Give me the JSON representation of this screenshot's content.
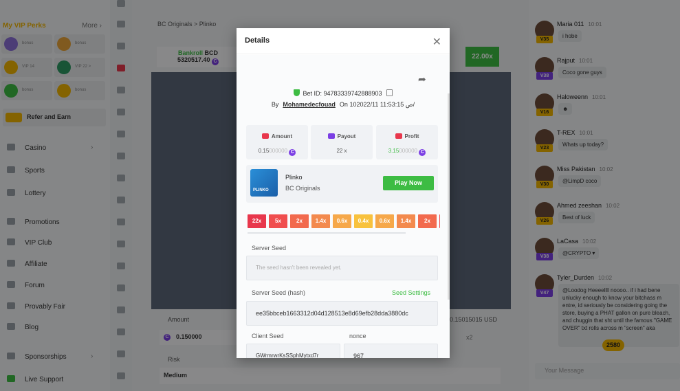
{
  "sidebar": {
    "vip_perks_title": "My VIP Perks",
    "vip_more": "More",
    "vip_cells": [
      {
        "label": "bonus"
      },
      {
        "label": "bonus"
      },
      {
        "label": "VIP 14"
      },
      {
        "label": "VIP 22 >"
      },
      {
        "label": "bonus"
      },
      {
        "label": "bonus"
      }
    ],
    "refer": "Refer and Earn",
    "nav": [
      {
        "label": "Casino",
        "chevron": true
      },
      {
        "label": "Sports",
        "chevron": false
      },
      {
        "label": "Lottery",
        "chevron": false
      },
      {
        "label": "Promotions",
        "chevron": false
      },
      {
        "label": "VIP Club",
        "chevron": false
      },
      {
        "label": "Affiliate",
        "chevron": false
      },
      {
        "label": "Forum",
        "chevron": false
      },
      {
        "label": "Provably Fair",
        "chevron": false
      },
      {
        "label": "Blog",
        "chevron": false
      },
      {
        "label": "Sponsorships",
        "chevron": true
      },
      {
        "label": "Live Support",
        "chevron": false
      }
    ]
  },
  "main": {
    "breadcrumb": "BC Originals  >  Plinko",
    "bankroll_label": "Bankroll",
    "bankroll_currency": "BCD",
    "bankroll_value": "5320517.40",
    "history_value": "22.00x",
    "amount_label": "Amount",
    "amount_value": "0.150000",
    "amount_usd": "0.15015015 USD",
    "amount_x2": "x2",
    "risk_label": "Risk",
    "risk_value": "Medium"
  },
  "chat": {
    "messages": [
      {
        "user": "Maria 011",
        "time": "10:01",
        "level": "V35",
        "text": "i hobe"
      },
      {
        "user": "Rajput",
        "time": "10:01",
        "level": "V38",
        "text": "Coco gone guys"
      },
      {
        "user": "Haloweenn",
        "time": "10:01",
        "level": "V16",
        "text": "☻"
      },
      {
        "user": "T-REX",
        "time": "10:01",
        "level": "V23",
        "text": "Whats up today?"
      },
      {
        "user": "Miss Pakistan",
        "time": "10:02",
        "level": "V30",
        "text": "@LimpD coco"
      },
      {
        "user": "Ahmed zeeshan",
        "time": "10:02",
        "level": "V26",
        "text": "Best of luck"
      },
      {
        "user": "LaCasa",
        "time": "10:02",
        "level": "V38",
        "text": "@CRYPTO ▾"
      },
      {
        "user": "Tyler_Durden",
        "time": "10:02",
        "level": "V47",
        "text": "@Loodog Heeeellll noooo.. if i had bene unlucky enough to know your bitchass m entre, id seriously be considering going the store, buying a PHAT gallon on pure bleach, and chuggin that sht until the famous \"GAME OVER\" txt rolls across m \"screen\" aka"
      }
    ],
    "unread_count": "2580",
    "input_placeholder": "Your Message"
  },
  "modal": {
    "title": "Details",
    "bet_id_label": "Bet ID:",
    "bet_id": "94783339742888903",
    "by_label": "By",
    "username": "Mohamedecfouad",
    "on_label": "On",
    "datetime": "10ص 11:53:15 2022/11/",
    "amount_label": "Amount",
    "amount_value": "0.15",
    "amount_zeros": "000000",
    "payout_label": "Payout",
    "payout_value": "22 x",
    "profit_label": "Profit",
    "profit_value": "3.15",
    "profit_zeros": "000000",
    "game_name": "Plinko",
    "game_provider": "BC Originals",
    "play_now": "Play Now",
    "thumb_text": "PLINKO",
    "multipliers": [
      {
        "v": "22x",
        "c": "#e8374c"
      },
      {
        "v": "5x",
        "c": "#f04e4e"
      },
      {
        "v": "2x",
        "c": "#f26a4e"
      },
      {
        "v": "1.4x",
        "c": "#f38a4e"
      },
      {
        "v": "0.6x",
        "c": "#f6a84a"
      },
      {
        "v": "0.4x",
        "c": "#f8c23e"
      },
      {
        "v": "0.6x",
        "c": "#f6a84a"
      },
      {
        "v": "1.4x",
        "c": "#f38a4e"
      },
      {
        "v": "2x",
        "c": "#f26a4e"
      },
      {
        "v": "5x",
        "c": "#f04e4e"
      }
    ],
    "server_seed_label": "Server Seed",
    "server_seed_placeholder": "The seed hasn't been revealed yet.",
    "server_seed_hash_label": "Server Seed (hash)",
    "seed_settings": "Seed Settings",
    "server_seed_hash": "ee35bbceb1663312d04d128513e8d69efb28dda3880dc",
    "client_seed_label": "Client Seed",
    "client_seed": "GWrmrwrKsSSphMytxd7r",
    "nonce_label": "nonce",
    "nonce": "967"
  },
  "colors": {
    "accent_green": "#3dbc43",
    "coin_purple": "#7b3fe4",
    "vip_gold": "#f0b400"
  }
}
